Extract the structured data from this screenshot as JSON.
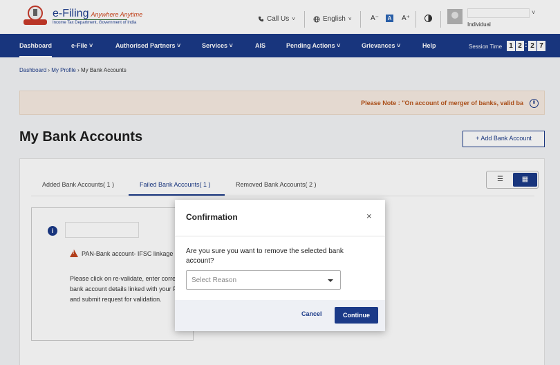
{
  "header": {
    "logo_title": "e-Filing",
    "logo_tagline": "Anywhere Anytime",
    "logo_subtitle": "Income Tax Department, Government of India",
    "call_us": "Call Us",
    "language": "English",
    "font_decrease": "A⁻",
    "font_normal": "A",
    "font_increase": "A⁺",
    "user_role": "Individual",
    "icons": [
      "emblem-logo",
      "phone-icon",
      "globe-icon",
      "contrast-icon",
      "avatar-icon",
      "chevron-down-icon"
    ]
  },
  "nav": {
    "items": [
      {
        "label": "Dashboard"
      },
      {
        "label": "e-File ˅"
      },
      {
        "label": "Authorised Partners ˅"
      },
      {
        "label": "Services ˅"
      },
      {
        "label": "AIS"
      },
      {
        "label": "Pending Actions ˅"
      },
      {
        "label": "Grievances ˅"
      },
      {
        "label": "Help"
      }
    ],
    "session_label": "Session Time",
    "session_digits": [
      "1",
      "2",
      "2",
      "7"
    ]
  },
  "breadcrumb": {
    "items": [
      "Dashboard",
      "My Profile",
      "My Bank Accounts"
    ]
  },
  "notice": {
    "text": "Please Note : \"On account of merger of banks, valid ba"
  },
  "page": {
    "title": "My Bank Accounts",
    "add_button": "+ Add Bank Account"
  },
  "tabs": [
    {
      "label": "Added Bank Accounts( 1 )"
    },
    {
      "label": "Failed Bank Accounts( 1 )"
    },
    {
      "label": "Removed Bank Accounts( 2 )"
    }
  ],
  "account_card": {
    "warning": "PAN-Bank account- IFSC linkage failed.",
    "help": "Please click on re-validate, enter correct bank account details linked with your PAN and submit request for validation."
  },
  "modal": {
    "title": "Confirmation",
    "close": "×",
    "question": "Are you sure you want to remove the selected bank account?",
    "select_placeholder": "Select Reason",
    "cancel": "Cancel",
    "continue": "Continue"
  },
  "colors": {
    "brand": "#1b3a88",
    "notice_text": "#b8541a",
    "warning": "#c2451f"
  }
}
